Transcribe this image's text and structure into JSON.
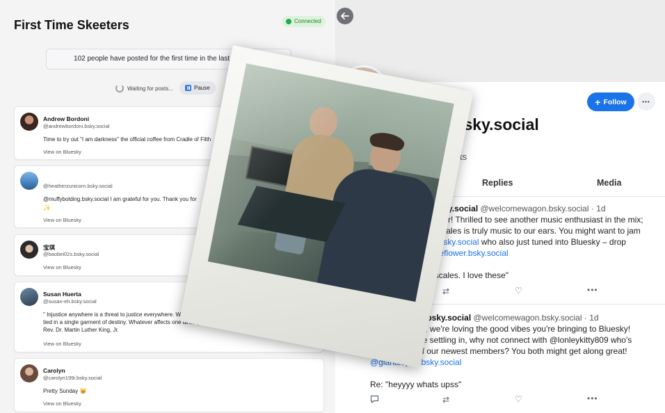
{
  "left": {
    "title": "First Time Skeeters",
    "status_badge": "Connected",
    "banner": "102 people have posted for the first time in the last 2 minutes!",
    "waiting": "Waiting for posts...",
    "pause": "Pause",
    "view_link": "View on Bluesky",
    "posts": [
      {
        "name": "Andrew Bordoni",
        "handle": "@andrewbordoni.bsky.social",
        "text": "Time to try out \"I am darkness\" the official coffee from Cradle of Filth"
      },
      {
        "name": "",
        "handle": "@heatherzunicorn.bsky.social",
        "text": "@muffybolding.bsky.social I am grateful for you. Thank you for"
      },
      {
        "name": "宝琪",
        "handle": "@baobei02s.bsky.social",
        "text": ""
      },
      {
        "name": "Susan Huerta",
        "handle": "@susan-eh.bsky.social",
        "text": "\" Injustice anywhere is a threat to justice everywhere. We are caught in an inescapable network of mutuality, tied in a single garment of destiny. Whatever affects one directly\nRev. Dr. Martin Luther King, Jr."
      },
      {
        "name": "Carolyn",
        "handle": "@carolyn199i.bsky.social",
        "text": "Pretty Sunday 😸"
      }
    ]
  },
  "right": {
    "follow_label": "Follow",
    "more_label": "•••",
    "profile_name": "n.bsky.social",
    "profile_handle": "ial",
    "profile_posts": "posts",
    "tabs": [
      "Replies",
      "Media"
    ],
    "posts": [
      {
        "user": ".bsky.social",
        "handle": "@welcomewagon.bsky.social · 1d",
        "line1": "ower! Thrilled to see another music enthusiast in the mix;",
        "line2": "r scales is truly music to our ears. You might want to jam",
        "line3_link": "pez.bsky.social",
        "line3_rest": " who also just tuned into Bluesky – drop",
        "line4_link": "@brieflower.bsky.social",
        "line5": "g on scales. I love these\""
      },
      {
        "user": "wagon.bsky.social",
        "handle": "@welcomewagon.bsky.social · 1d",
        "line1": "alopez, we're loving the good vibes you're bringing to Bluesky!",
        "line2": "ou're settling in, why not connect with @lonleykitty809 who's",
        "line3": "e of our newest members? You both might get along great!",
        "line4_link": "@gianalopez.bsky.social",
        "line5": "Re: \"heyyyy whats upss\""
      }
    ]
  },
  "colors": {
    "accent": "#1a73e8",
    "badge_bg": "#dcf3dc",
    "badge_dot": "#22a94b"
  }
}
